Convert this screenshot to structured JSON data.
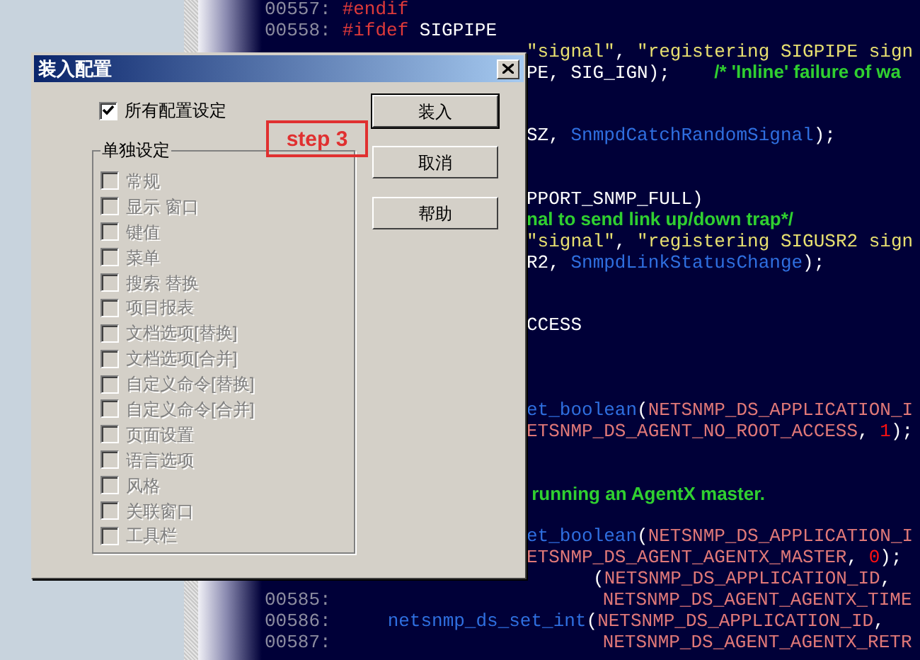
{
  "editor": {
    "lines": [
      {
        "kind": "top",
        "number": "00557:",
        "tokens": [
          {
            "kind": "keyword",
            "text": "#endif"
          }
        ]
      },
      {
        "kind": "top",
        "number": "00558:",
        "tokens": [
          {
            "kind": "keyword",
            "text": "#ifdef"
          },
          {
            "kind": "plain",
            "text": " SIGPIPE"
          }
        ]
      },
      {
        "kind": "covered",
        "tokens": [
          {
            "kind": "string",
            "text": "\"signal\""
          },
          {
            "kind": "plain",
            "text": ", "
          },
          {
            "kind": "string",
            "text": "\"registering SIGPIPE sign"
          }
        ]
      },
      {
        "kind": "covered",
        "tokens": [
          {
            "kind": "plain",
            "text": "PE, SIG_IGN);    "
          },
          {
            "kind": "comment",
            "text": "/* 'Inline' failure of wa"
          }
        ]
      },
      {
        "kind": "blank"
      },
      {
        "kind": "blank"
      },
      {
        "kind": "covered",
        "tokens": [
          {
            "kind": "plain",
            "text": "SZ, "
          },
          {
            "kind": "function",
            "text": "SnmpdCatchRandomSignal"
          },
          {
            "kind": "plain",
            "text": ");"
          }
        ]
      },
      {
        "kind": "blank"
      },
      {
        "kind": "blank"
      },
      {
        "kind": "covered",
        "tokens": [
          {
            "kind": "plain",
            "text": "PPORT_SNMP_FULL)"
          }
        ]
      },
      {
        "kind": "covered",
        "tokens": [
          {
            "kind": "comment",
            "text": "nal to send link up/down trap*/"
          }
        ]
      },
      {
        "kind": "covered",
        "tokens": [
          {
            "kind": "string",
            "text": "\"signal\""
          },
          {
            "kind": "plain",
            "text": ", "
          },
          {
            "kind": "string",
            "text": "\"registering SIGUSR2 sign"
          }
        ]
      },
      {
        "kind": "covered",
        "tokens": [
          {
            "kind": "plain",
            "text": "R2, "
          },
          {
            "kind": "function",
            "text": "SnmpdLinkStatusChange"
          },
          {
            "kind": "plain",
            "text": ");"
          }
        ]
      },
      {
        "kind": "blank"
      },
      {
        "kind": "blank"
      },
      {
        "kind": "covered",
        "tokens": [
          {
            "kind": "plain",
            "text": "CCESS"
          }
        ]
      },
      {
        "kind": "blank"
      },
      {
        "kind": "blank"
      },
      {
        "kind": "blank"
      },
      {
        "kind": "covered",
        "tokens": [
          {
            "kind": "function",
            "text": "et_boolean"
          },
          {
            "kind": "plain",
            "text": "("
          },
          {
            "kind": "constant",
            "text": "NETSNMP_DS_APPLICATION_I"
          }
        ]
      },
      {
        "kind": "covered",
        "tokens": [
          {
            "kind": "constant",
            "text": "ETSNMP_DS_AGENT_NO_ROOT_ACCESS"
          },
          {
            "kind": "plain",
            "text": ", "
          },
          {
            "kind": "number",
            "text": "1"
          },
          {
            "kind": "plain",
            "text": ");"
          }
        ]
      },
      {
        "kind": "blank"
      },
      {
        "kind": "blank"
      },
      {
        "kind": "covered",
        "tokens": [
          {
            "kind": "comment",
            "text": " running an AgentX master."
          }
        ]
      },
      {
        "kind": "blank"
      },
      {
        "kind": "covered",
        "tokens": [
          {
            "kind": "function",
            "text": "et_boolean"
          },
          {
            "kind": "plain",
            "text": "("
          },
          {
            "kind": "constant",
            "text": "NETSNMP_DS_APPLICATION_I"
          }
        ]
      },
      {
        "kind": "covered",
        "tokens": [
          {
            "kind": "constant",
            "text": "ETSNMP_DS_AGENT_AGENTX_MASTER"
          },
          {
            "kind": "plain",
            "text": ", "
          },
          {
            "kind": "number",
            "text": "0"
          },
          {
            "kind": "plain",
            "text": ");"
          }
        ]
      },
      {
        "kind": "tail",
        "tokens": [
          {
            "kind": "plain",
            "text": "("
          },
          {
            "kind": "constant",
            "text": "NETSNMP_DS_APPLICATION_ID"
          },
          {
            "kind": "plain",
            "text": ","
          }
        ]
      },
      {
        "kind": "continuation",
        "number": "00585:",
        "tokens": [
          {
            "kind": "constant",
            "text": "NETSNMP_DS_AGENT_AGENTX_TIME"
          }
        ]
      },
      {
        "kind": "inner",
        "number": "00586:",
        "tokens": [
          {
            "kind": "function",
            "text": "netsnmp_ds_set_int"
          },
          {
            "kind": "plain",
            "text": "("
          },
          {
            "kind": "constant",
            "text": "NETSNMP_DS_APPLICATION_ID"
          },
          {
            "kind": "plain",
            "text": ","
          }
        ]
      },
      {
        "kind": "continuation",
        "number": "00587:",
        "tokens": [
          {
            "kind": "constant",
            "text": "NETSNMP_DS_AGENT_AGENTX_RETR"
          }
        ]
      }
    ]
  },
  "dialog": {
    "title": "装入配置",
    "all_settings": {
      "label": "所有配置设定",
      "checked": true
    },
    "group": {
      "title": "单独设定",
      "items": [
        {
          "label": "常规",
          "checked": false,
          "disabled": true
        },
        {
          "label": "显示 窗口",
          "checked": false,
          "disabled": true
        },
        {
          "label": "键值",
          "checked": false,
          "disabled": true
        },
        {
          "label": "菜单",
          "checked": false,
          "disabled": true
        },
        {
          "label": "搜索 替换",
          "checked": false,
          "disabled": true
        },
        {
          "label": "项目报表",
          "checked": false,
          "disabled": true
        },
        {
          "label": "文档选项[替换]",
          "checked": false,
          "disabled": true
        },
        {
          "label": "文档选项[合并]",
          "checked": false,
          "disabled": true
        },
        {
          "label": "自定义命令[替换]",
          "checked": false,
          "disabled": true
        },
        {
          "label": "自定义命令[合并]",
          "checked": false,
          "disabled": true
        },
        {
          "label": "页面设置",
          "checked": false,
          "disabled": true
        },
        {
          "label": "语言选项",
          "checked": false,
          "disabled": true
        },
        {
          "label": "风格",
          "checked": false,
          "disabled": true
        },
        {
          "label": "关联窗口",
          "checked": false,
          "disabled": true
        },
        {
          "label": "工具栏",
          "checked": false,
          "disabled": true
        }
      ]
    },
    "buttons": [
      {
        "label": "装入",
        "default": true
      },
      {
        "label": "取消",
        "default": false
      },
      {
        "label": "帮助",
        "default": false
      }
    ]
  },
  "annotation": {
    "text": "step 3"
  }
}
